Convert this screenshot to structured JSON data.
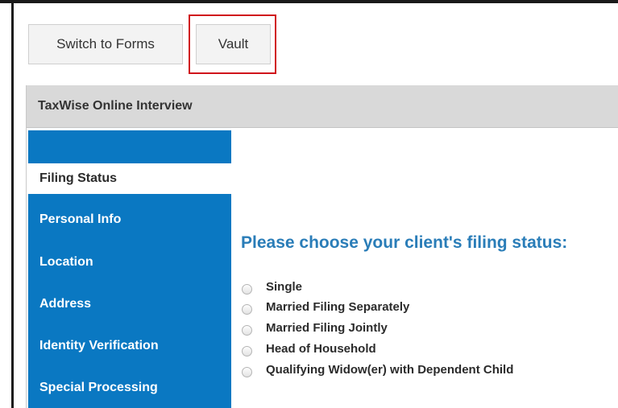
{
  "toolbar": {
    "switch_label": "Switch to Forms",
    "vault_label": "Vault"
  },
  "panel": {
    "title": "TaxWise Online Interview"
  },
  "sidebar": {
    "items": [
      {
        "label": "Filing Status",
        "active": true
      },
      {
        "label": "Personal Info",
        "active": false
      },
      {
        "label": "Location",
        "active": false
      },
      {
        "label": "Address",
        "active": false
      },
      {
        "label": "Identity Verification",
        "active": false
      },
      {
        "label": "Special Processing",
        "active": false
      }
    ]
  },
  "main": {
    "question": "Please choose your client's filing status:",
    "options": [
      {
        "label": "Single",
        "checked": false
      },
      {
        "label": "Married Filing Separately",
        "checked": false
      },
      {
        "label": "Married Filing Jointly",
        "checked": false
      },
      {
        "label": "Head of Household",
        "checked": false
      },
      {
        "label": "Qualifying Widow(er) with Dependent Child",
        "checked": false
      }
    ]
  },
  "colors": {
    "sidebar_blue": "#0a78c2",
    "question_blue": "#2a7db8",
    "highlight_red": "#d0141b",
    "header_gray": "#d9d9d9"
  }
}
